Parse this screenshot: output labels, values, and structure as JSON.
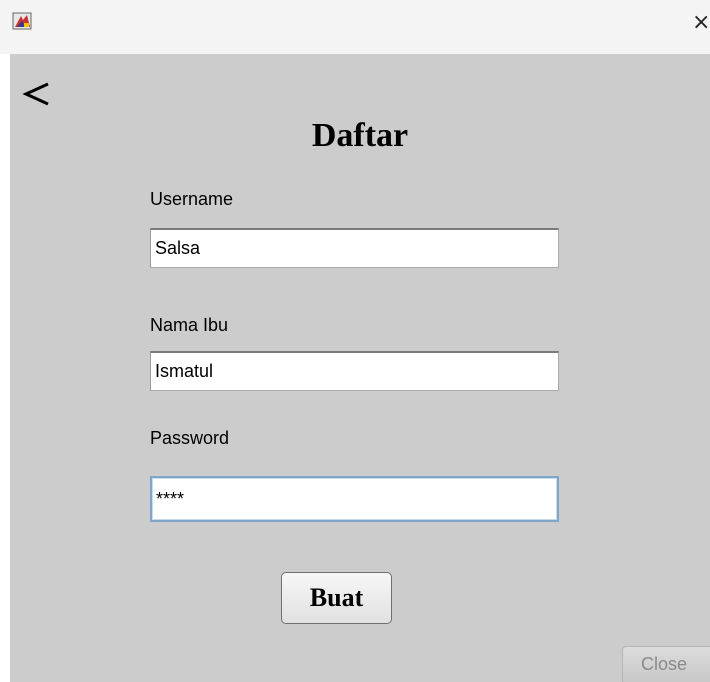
{
  "window": {
    "close_glyph": "×"
  },
  "nav": {
    "back_glyph": "<"
  },
  "form": {
    "title": "Daftar",
    "username_label": "Username",
    "username_value": "Salsa",
    "mother_name_label": "Nama Ibu",
    "mother_name_value": "Ismatul",
    "password_label": "Password",
    "password_value": "****",
    "submit_label": "Buat"
  },
  "footer": {
    "close_label": "Close"
  },
  "icons": {
    "app": "java-app-icon",
    "back": "back-arrow-icon",
    "window_close": "close-icon"
  },
  "colors": {
    "content_background": "#cccccc",
    "titlebar_background": "#f4f4f4",
    "focus_border": "#7fa6c8",
    "close_text": "#8a8a8a"
  }
}
